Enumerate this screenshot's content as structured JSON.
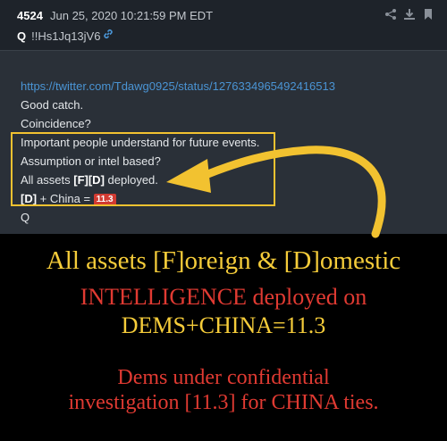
{
  "post": {
    "number": "4524",
    "date": "Jun 25, 2020 10:21:59 PM EDT",
    "author": "Q",
    "tripcode": "!!Hs1Jq13jV6",
    "lines": [
      "https://twitter.com/Tdawg0925/status/1276334965492416513",
      "Good catch.",
      "Coincidence?",
      "Important people understand for future events.",
      "Assumption or intel based?"
    ],
    "assets_prefix": "All assets ",
    "assets_bold": "[F][D]",
    "assets_suffix": " deployed.",
    "china_bold": "[D]",
    "china_text": " + China = ",
    "china_badge": "11.3",
    "signature": "Q"
  },
  "captions": {
    "line1": "All assets [F]oreign & [D]omestic",
    "line2": "INTELLIGENCE deployed on",
    "line3": "DEMS+CHINA=11.3",
    "line4": "Dems under confidential",
    "line5": "investigation [11.3] for CHINA ties."
  },
  "colors": {
    "highlight": "#f2c230",
    "caption_gold": "#f5cc3a",
    "caption_red": "#e03a32",
    "badge": "#d13b32",
    "link": "#4a94d4"
  },
  "icons": [
    "share-icon",
    "download-icon",
    "bookmark-icon",
    "link-icon"
  ]
}
